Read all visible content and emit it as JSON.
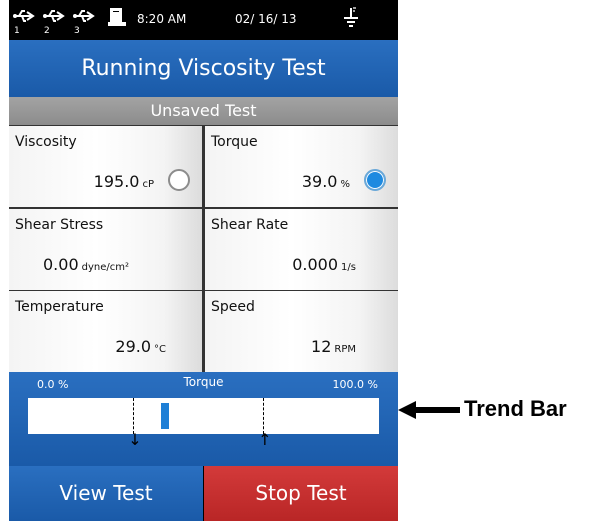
{
  "status_bar": {
    "usb_ports": [
      "1",
      "2",
      "3"
    ],
    "time": "8:20 AM",
    "date": "02/ 16/ 13"
  },
  "title": "Running Viscosity Test",
  "subtitle": "Unsaved Test",
  "readings": [
    {
      "label": "Viscosity",
      "value": "195.0",
      "unit": "cP",
      "indicator": "inactive"
    },
    {
      "label": "Torque",
      "value": "39.0",
      "unit": "%",
      "indicator": "active"
    },
    {
      "label": "Shear Stress",
      "value": "0.00",
      "unit": "dyne/cm²"
    },
    {
      "label": "Shear Rate",
      "value": "0.000",
      "unit": "1/s"
    },
    {
      "label": "Temperature",
      "value": "29.0",
      "unit": "°C"
    },
    {
      "label": "Speed",
      "value": "12",
      "unit": "RPM"
    }
  ],
  "trend_bar": {
    "title": "Torque",
    "min_label": "0.0 %",
    "max_label": "100.0 %",
    "value_percent": 39,
    "low_limit_percent": 30,
    "high_limit_percent": 67
  },
  "buttons": {
    "view": "View Test",
    "stop": "Stop Test"
  },
  "callout": "Trend Bar",
  "colors": {
    "accent_blue": "#1a5aa8",
    "stop_red": "#c62e2e",
    "header_gray": "#999999",
    "indicator_blue": "#1e8ae0"
  }
}
